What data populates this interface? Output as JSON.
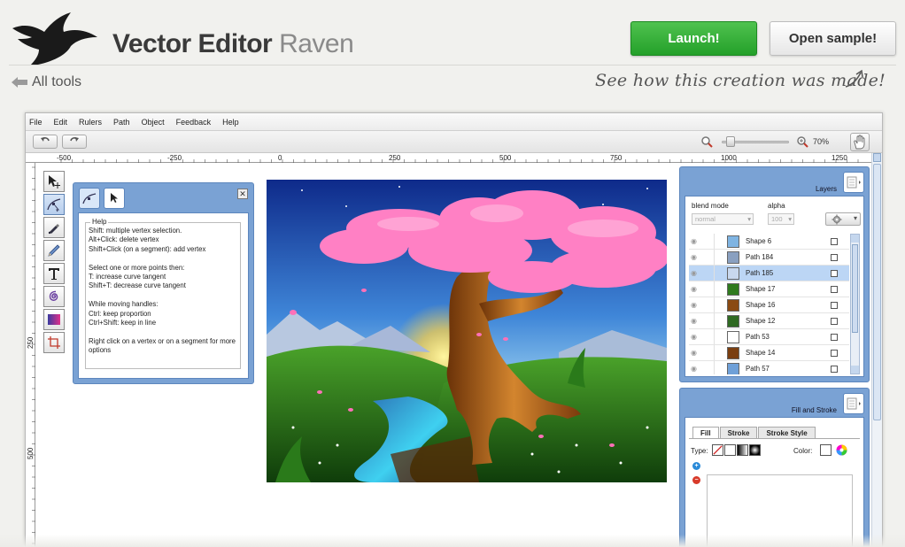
{
  "header": {
    "title_main": "Vector Editor",
    "title_sub": "Raven",
    "launch_label": "Launch!",
    "sample_label": "Open sample!",
    "all_tools_label": "All tools",
    "see_how_label": "See how this creation was made!"
  },
  "menu": {
    "items": [
      "File",
      "Edit",
      "Rulers",
      "Path",
      "Object",
      "Feedback",
      "Help"
    ]
  },
  "toolbar": {
    "zoom_label": "70%",
    "zoom_fraction": 0.08
  },
  "ruler": {
    "h_labels": [
      "-500",
      "-250",
      "0",
      "250",
      "500",
      "750",
      "1000",
      "1250"
    ],
    "v_labels": [
      "250",
      "500"
    ]
  },
  "tools": {
    "icons": [
      "select-icon",
      "node-edit-icon",
      "pen-icon",
      "pencil-icon",
      "text-icon",
      "spiral-icon",
      "gradient-icon",
      "crop-icon"
    ]
  },
  "help": {
    "legend": "Help",
    "text": "Shift: multiple vertex selection.\nAlt+Click: delete vertex\nShift+Click (on a segment): add vertex\n\nSelect one or more points then:\nT: increase curve tangent\nShift+T: decrease curve tangent\n\nWhile moving handles:\nCtrl: keep proportion\nCtrl+Shift: keep in line\n\nRight click on a vertex or on a segment for more\noptions"
  },
  "layers": {
    "title": "Layers",
    "blend_label": "blend mode",
    "alpha_label": "alpha",
    "blend_value": "normal",
    "alpha_value": "100",
    "items": [
      {
        "name": "Shape 6",
        "color": "#7fb4e2",
        "selected": false
      },
      {
        "name": "Path 184",
        "color": "#8aa0c0",
        "selected": false
      },
      {
        "name": "Path 185",
        "color": "#c8d8ee",
        "selected": true
      },
      {
        "name": "Shape 17",
        "color": "#2f7a1e",
        "selected": false
      },
      {
        "name": "Shape 16",
        "color": "#8a4a12",
        "selected": false
      },
      {
        "name": "Shape 12",
        "color": "#2f6a22",
        "selected": false
      },
      {
        "name": "Path 53",
        "color": "#ffffff",
        "selected": false
      },
      {
        "name": "Shape 14",
        "color": "#7a3e10",
        "selected": false
      },
      {
        "name": "Path 57",
        "color": "#6fa0d8",
        "selected": false
      }
    ]
  },
  "fill_stroke": {
    "title": "Fill and Stroke",
    "tabs": [
      "Fill",
      "Stroke",
      "Stroke Style"
    ],
    "type_label": "Type:",
    "color_label": "Color:"
  },
  "colors": {
    "accent_blue": "#7aa2d4",
    "launch_green": "#2fae33",
    "foliage_pink": "#ff7fc0"
  }
}
